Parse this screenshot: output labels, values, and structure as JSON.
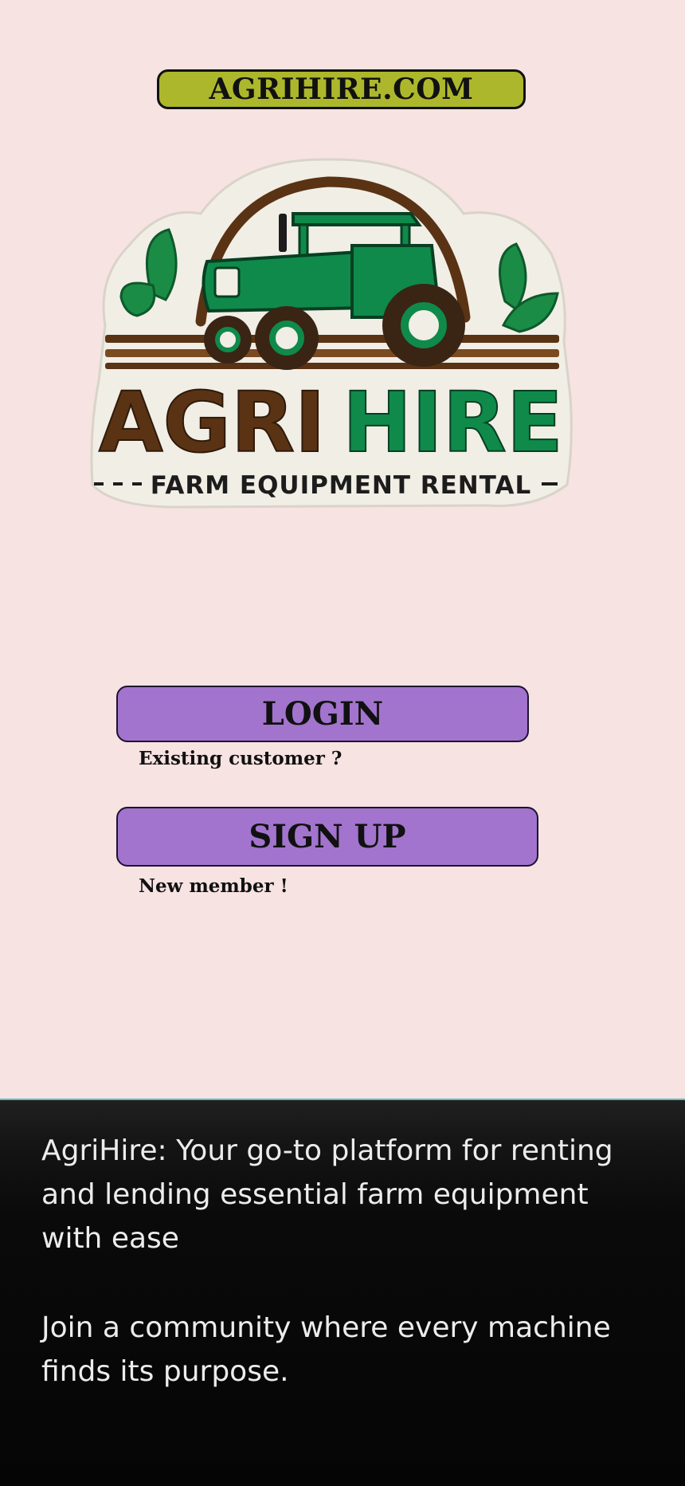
{
  "header": {
    "site_name": "AGRIHIRE.COM"
  },
  "logo": {
    "word_part1": "AGRI",
    "word_part2": "HIRE",
    "subtitle": "FARM EQUIPMENT RENTAL",
    "icon": "tractor-icon",
    "colors": {
      "brown": "#5a3314",
      "green": "#0f8a4a",
      "cream": "#f1eee6"
    }
  },
  "actions": {
    "login_label": "LOGIN",
    "login_caption": "Existing customer ?",
    "signup_label": "SIGN UP",
    "signup_caption": "New member !"
  },
  "footer": {
    "tagline": "AgriHire: Your go-to platform for renting and lending essential farm equipment with ease",
    "community": "Join a community where every machine finds its purpose."
  },
  "colors": {
    "page_bg": "#f6e3e2",
    "pill_bg": "#adb72c",
    "button_bg": "#a274cd",
    "footer_bg": "#0a0a0a",
    "footer_text": "#ececec"
  }
}
